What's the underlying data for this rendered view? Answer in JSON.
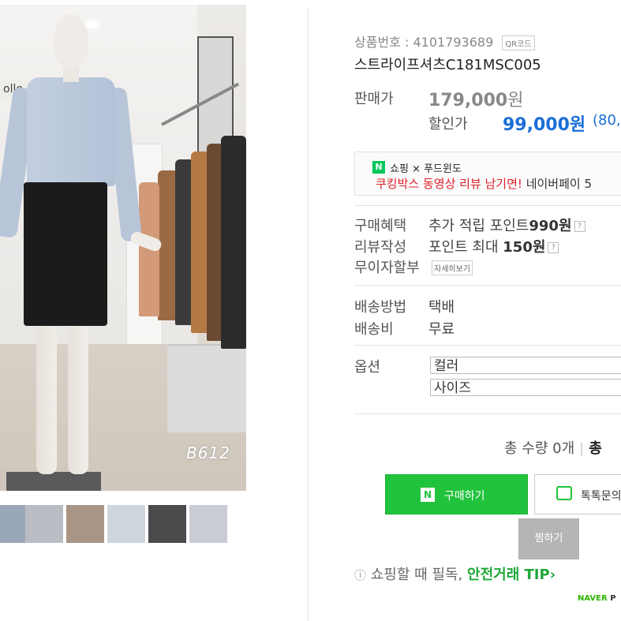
{
  "product": {
    "number_label": "상품번호 :",
    "number": "4101793689",
    "qr_button": "QR코드",
    "name": "스트라이프셔츠C181MSC005"
  },
  "photo": {
    "sign_text": "olle",
    "watermark": "B612"
  },
  "thumbnails": [
    {
      "color": "#9aa7b8"
    },
    {
      "color": "#b9bcc2"
    },
    {
      "color": "#a89586"
    },
    {
      "color": "#cfd5dd"
    },
    {
      "color": "#4b4b4e"
    },
    {
      "color": "#c9cdd3"
    }
  ],
  "price": {
    "original_label": "판매가",
    "original_value": "179,000",
    "original_unit": "원",
    "sale_label": "할인가",
    "sale_value": "99,000원",
    "sale_rate": "(80,"
  },
  "promo": {
    "badge": "N",
    "title": "쇼핑 × 푸드윈도",
    "highlight": "쿠킹박스 동영상 리뷰 남기면!",
    "rest": " 네이버페이 5"
  },
  "benefits": {
    "purchase_label": "구매혜택",
    "purchase_text": "추가 적립 포인트",
    "purchase_amount": "990원",
    "review_label": "리뷰작성",
    "review_text": "포인트 최대",
    "review_amount": "150원",
    "installment_label": "무이자할부",
    "detail_button": "자세히보기",
    "help_mark": "?"
  },
  "shipping": {
    "method_label": "배송방법",
    "method_value": "택배",
    "fee_label": "배송비",
    "fee_value": "무료"
  },
  "options": {
    "label": "옵션",
    "color_select": "컬러",
    "size_select": "사이즈"
  },
  "total": {
    "quantity_text": "총 수량 0개",
    "total_label": "총"
  },
  "buttons": {
    "buy_badge": "N",
    "buy": "구매하기",
    "talk": "톡톡문의",
    "wish": "찜하기"
  },
  "tip": {
    "icon": "ⓘ",
    "text": "쇼핑할 때 필독,",
    "link": "안전거래 TIP",
    "arrow": "›"
  },
  "footer": {
    "naver": "NAVER",
    "p": "P"
  },
  "colors": {
    "accent_green": "#22c33c",
    "price_blue": "#1a6ed8",
    "promo_red": "#e0202c"
  }
}
